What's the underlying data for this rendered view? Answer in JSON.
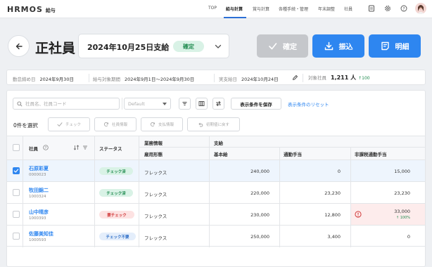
{
  "nav": {
    "logo": "HRMOS",
    "logo_sub": "給与",
    "items": [
      {
        "label": "TOP",
        "active": false
      },
      {
        "label": "給与計算",
        "active": true
      },
      {
        "label": "賞与計算",
        "active": false
      },
      {
        "label": "各種手続・管理",
        "active": false
      },
      {
        "label": "年末調整",
        "active": false
      },
      {
        "label": "社員",
        "active": false
      }
    ],
    "icons": [
      "document-icon",
      "gear-icon",
      "help-icon"
    ]
  },
  "header": {
    "title": "正社員",
    "period": "2024年10月25日支給",
    "status_badge": "確定",
    "buttons": {
      "confirm": "確定",
      "transfer": "振込",
      "detail": "明細"
    }
  },
  "info": {
    "closing_label": "勤怠締め日",
    "closing_value": "2024年9月30日",
    "period_label": "給与対象期間",
    "period_value": "2024年9月1日〜2024年9月30日",
    "payday_label": "実支給日",
    "payday_value": "2024年10月24日",
    "employees_label": "対象社員",
    "employees_value": "1,211 人",
    "employees_diff": "↑100"
  },
  "toolbar": {
    "search_placeholder": "社員名、社員コード",
    "select_value": "Default",
    "save_label": "表示条件を保存",
    "reset_label": "表示条件のリセット"
  },
  "bulk": {
    "selected_count": "0件を選択",
    "check": "チェック",
    "emp_info": "社員情報",
    "pay_info": "支払情報",
    "reset_initial": "初期値に戻す"
  },
  "table": {
    "group_headers": {
      "work": "業務情報",
      "pay": "支給"
    },
    "headers": {
      "employee": "社員",
      "status": "ステータス",
      "employment_type": "雇用形態",
      "base_salary": "基本給",
      "commute": "通勤手当",
      "nontax_commute": "非課税通勤手当"
    },
    "rows": [
      {
        "name": "石原彩夏",
        "code": "0000023",
        "status": "チェック済",
        "status_kind": "done",
        "type": "フレックス",
        "base": "240,000",
        "commute": "0",
        "nontax": "15,000",
        "nontax_note": "",
        "checked": true,
        "warn": false
      },
      {
        "name": "牧田錦二",
        "code": "1000324",
        "status": "チェック済",
        "status_kind": "done",
        "type": "フレックス",
        "base": "220,000",
        "commute": "23,230",
        "nontax": "23,230",
        "nontax_note": "",
        "checked": false,
        "warn": false
      },
      {
        "name": "山中晴彦",
        "code": "1000393",
        "status": "要チェック",
        "status_kind": "need",
        "type": "フレックス",
        "base": "230,000",
        "commute": "12,800",
        "nontax": "33,000",
        "nontax_note": "↑ 100%",
        "checked": false,
        "warn": true
      },
      {
        "name": "佐藤美知佳",
        "code": "1000593",
        "status": "チェック不要",
        "status_kind": "none",
        "type": "フレックス",
        "base": "250,000",
        "commute": "3,400",
        "nontax": "0",
        "nontax_note": "",
        "checked": false,
        "warn": false
      }
    ]
  },
  "colors": {
    "accent": "#2e86f0",
    "success": "#1e8a4e",
    "danger": "#d13b3b",
    "disabled": "#c5c7cb"
  }
}
